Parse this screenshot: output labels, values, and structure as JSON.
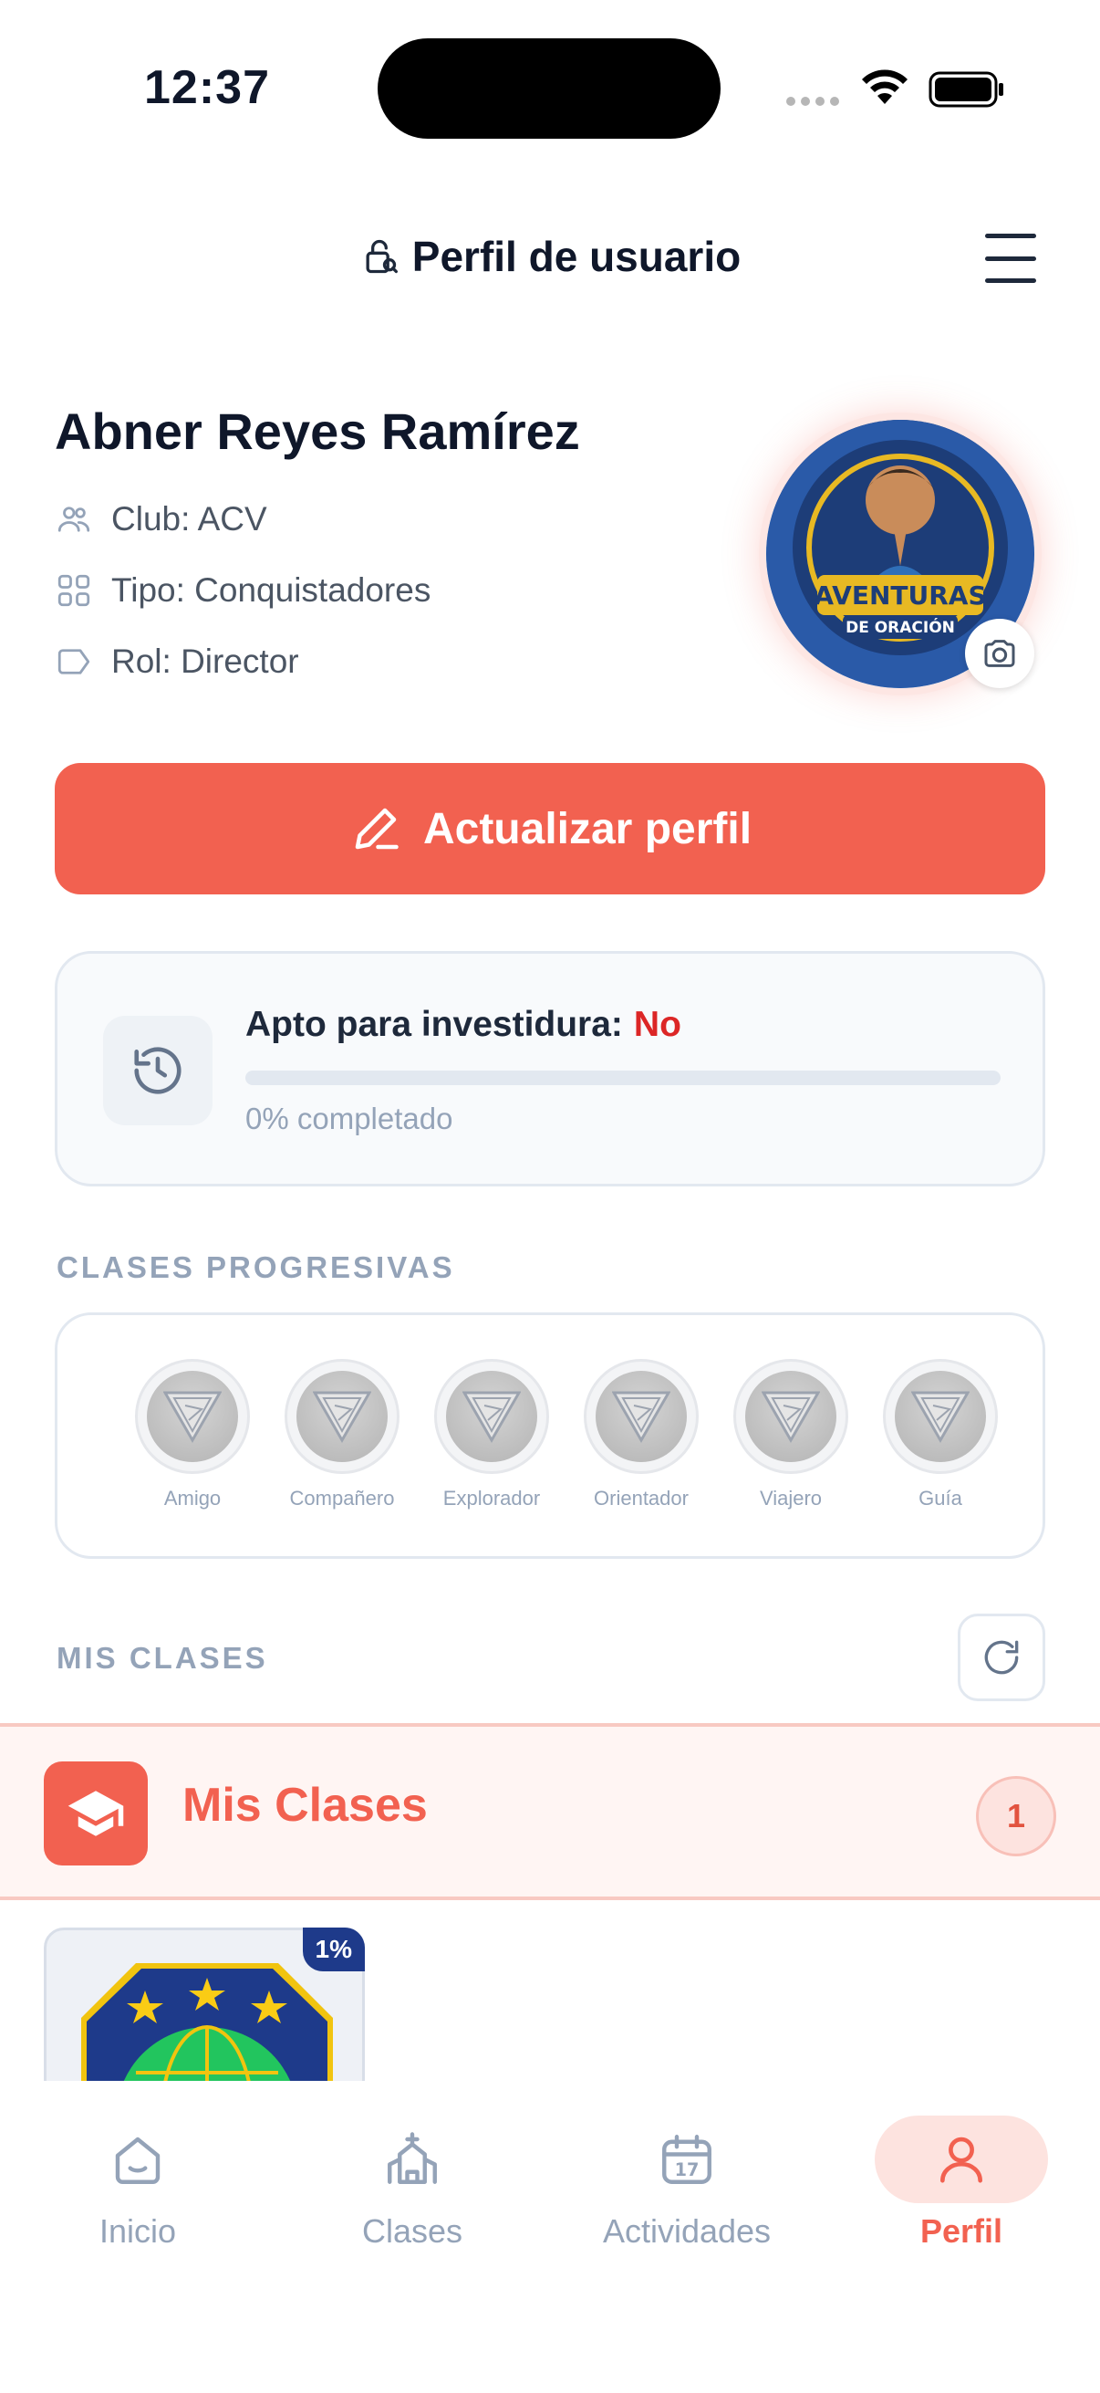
{
  "status_bar": {
    "time": "12:37"
  },
  "header": {
    "title": "Perfil de usuario"
  },
  "profile": {
    "name": "Abner Reyes Ramírez",
    "club": "Club: ACV",
    "tipo": "Tipo: Conquistadores",
    "rol": "Rol: Director",
    "avatar_text_1": "AVENTURAS",
    "avatar_text_2": "DE ORACIÓN"
  },
  "update_button": {
    "label": "Actualizar perfil"
  },
  "investiture": {
    "label": "Apto para investidura:",
    "value": "No",
    "progress": 0,
    "progress_text": "0% completado"
  },
  "progressive_classes": {
    "section_label": "CLASES PROGRESIVAS",
    "items": [
      {
        "name": "Amigo"
      },
      {
        "name": "Compañero"
      },
      {
        "name": "Explorador"
      },
      {
        "name": "Orientador"
      },
      {
        "name": "Viajero"
      },
      {
        "name": "Guía"
      }
    ]
  },
  "my_classes": {
    "section_label": "MIS CLASES",
    "bar_title": "Mis Clases",
    "count": "1",
    "cards": [
      {
        "percent": "1%"
      }
    ]
  },
  "nav": {
    "items": [
      {
        "label": "Inicio",
        "icon": "home-icon"
      },
      {
        "label": "Clases",
        "icon": "church-icon"
      },
      {
        "label": "Actividades",
        "icon": "calendar-icon",
        "calendar_day": "17"
      },
      {
        "label": "Perfil",
        "icon": "user-icon",
        "active": true
      }
    ]
  },
  "colors": {
    "accent": "#f26150",
    "danger": "#dc2626",
    "muted": "#94a3b8",
    "navy": "#1e3a8a"
  }
}
